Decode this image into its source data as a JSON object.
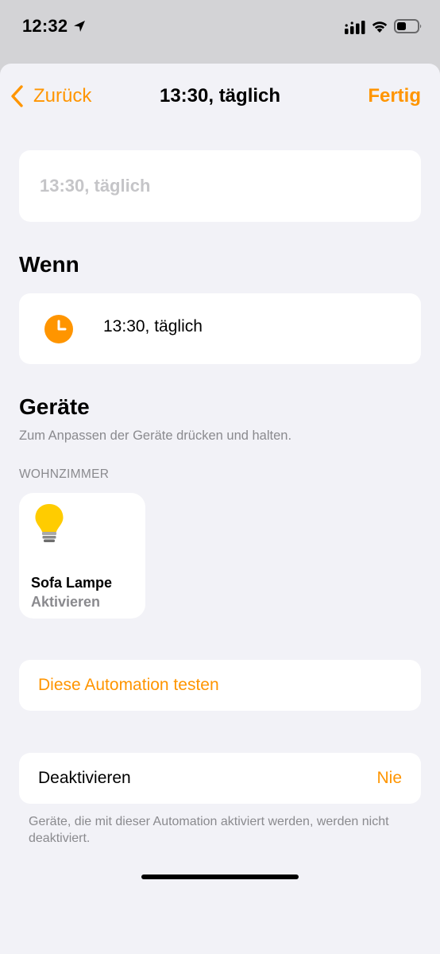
{
  "status_bar": {
    "time": "12:32",
    "icons": [
      "location-arrow-icon",
      "cellular-signal-icon",
      "wifi-icon",
      "battery-icon"
    ]
  },
  "nav": {
    "back_label": "Zurück",
    "title": "13:30, täglich",
    "done_label": "Fertig"
  },
  "name_field": {
    "placeholder": "13:30, täglich"
  },
  "when": {
    "heading": "Wenn",
    "trigger_icon": "clock-icon",
    "trigger_text": "13:30, täglich"
  },
  "devices": {
    "heading": "Geräte",
    "hint": "Zum Anpassen der Geräte drücken und halten.",
    "room": "WOHNZIMMER",
    "items": [
      {
        "icon": "lightbulb-icon",
        "name": "Sofa Lampe",
        "status": "Aktivieren"
      }
    ]
  },
  "test_automation_label": "Diese Automation testen",
  "deactivate": {
    "label": "Deaktivieren",
    "value": "Nie",
    "footnote": "Geräte, die mit dieser Automation aktiviert werden, werden nicht deaktiviert."
  },
  "colors": {
    "accent": "#ff9500",
    "background": "#f2f2f7",
    "secondary_text": "#8a8a8e"
  }
}
